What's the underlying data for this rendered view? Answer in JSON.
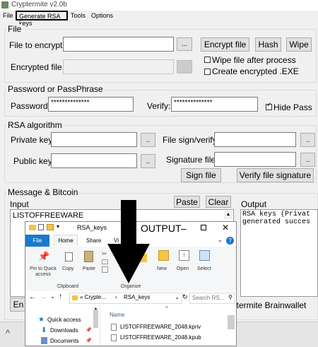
{
  "app": {
    "title": "Cryptermite v2.0b"
  },
  "menu": {
    "items": [
      "File",
      "Generate RSA keys",
      "Tools",
      "Options"
    ]
  },
  "file_group": {
    "title": "File",
    "encrypt_label": "File to encrypt:",
    "encrypted_label": "Encrypted file:",
    "browse": "...",
    "encrypt_btn": "Encrypt file",
    "hash_btn": "Hash",
    "wipe_btn": "Wipe",
    "wipe_after": "Wipe file after process",
    "create_exe": "Create encrypted .EXE"
  },
  "password_group": {
    "title": "Password or PassPhrase",
    "password_label": "Password:",
    "password_value": "**************",
    "verify_label": "Verify:",
    "verify_value": "**************",
    "hide_label": "Hide Pass"
  },
  "rsa_group": {
    "title": "RSA algorithm",
    "private_label": "Private key:",
    "public_label": "Public key:",
    "sign_verify_label": "File sign/verify:",
    "signature_label": "Signature file:",
    "browse": "..",
    "sign_btn": "Sign file",
    "verify_sig_btn": "Verify file signature"
  },
  "message_group": {
    "title": "Message & Bitcoin",
    "input_label": "Input",
    "paste_btn": "Paste",
    "clear_btn": "Clear",
    "output_label": "Output",
    "input_text": "LISTOFFREEWARE",
    "output_text": "RSA keys (Privat\ngenerated succes",
    "en_btn": "En",
    "brainwallet_text": "ptermite Brainwallet"
  },
  "overlay": {
    "output_label": "OUTPUT",
    "dash": "–"
  },
  "explorer": {
    "title": "RSA_keys",
    "tabs": [
      "File",
      "Home",
      "Share",
      "Vi"
    ],
    "ribbon": {
      "pin": "Pin to Quick access",
      "copy": "Copy",
      "paste": "Paste",
      "new": "New",
      "open": "Open",
      "select": "Select",
      "clipboard": "Clipboard",
      "organize": "Organize"
    },
    "address": [
      "« Crypte...",
      "RSA_keys"
    ],
    "search_placeholder": "Search RS...",
    "nav": [
      "Quick access",
      "Downloads",
      "Documents"
    ],
    "column_name": "Name",
    "files": [
      "LISTOFFREEWARE_2048.kpriv",
      "LISTOFFREEWARE_2048.kpub"
    ]
  }
}
